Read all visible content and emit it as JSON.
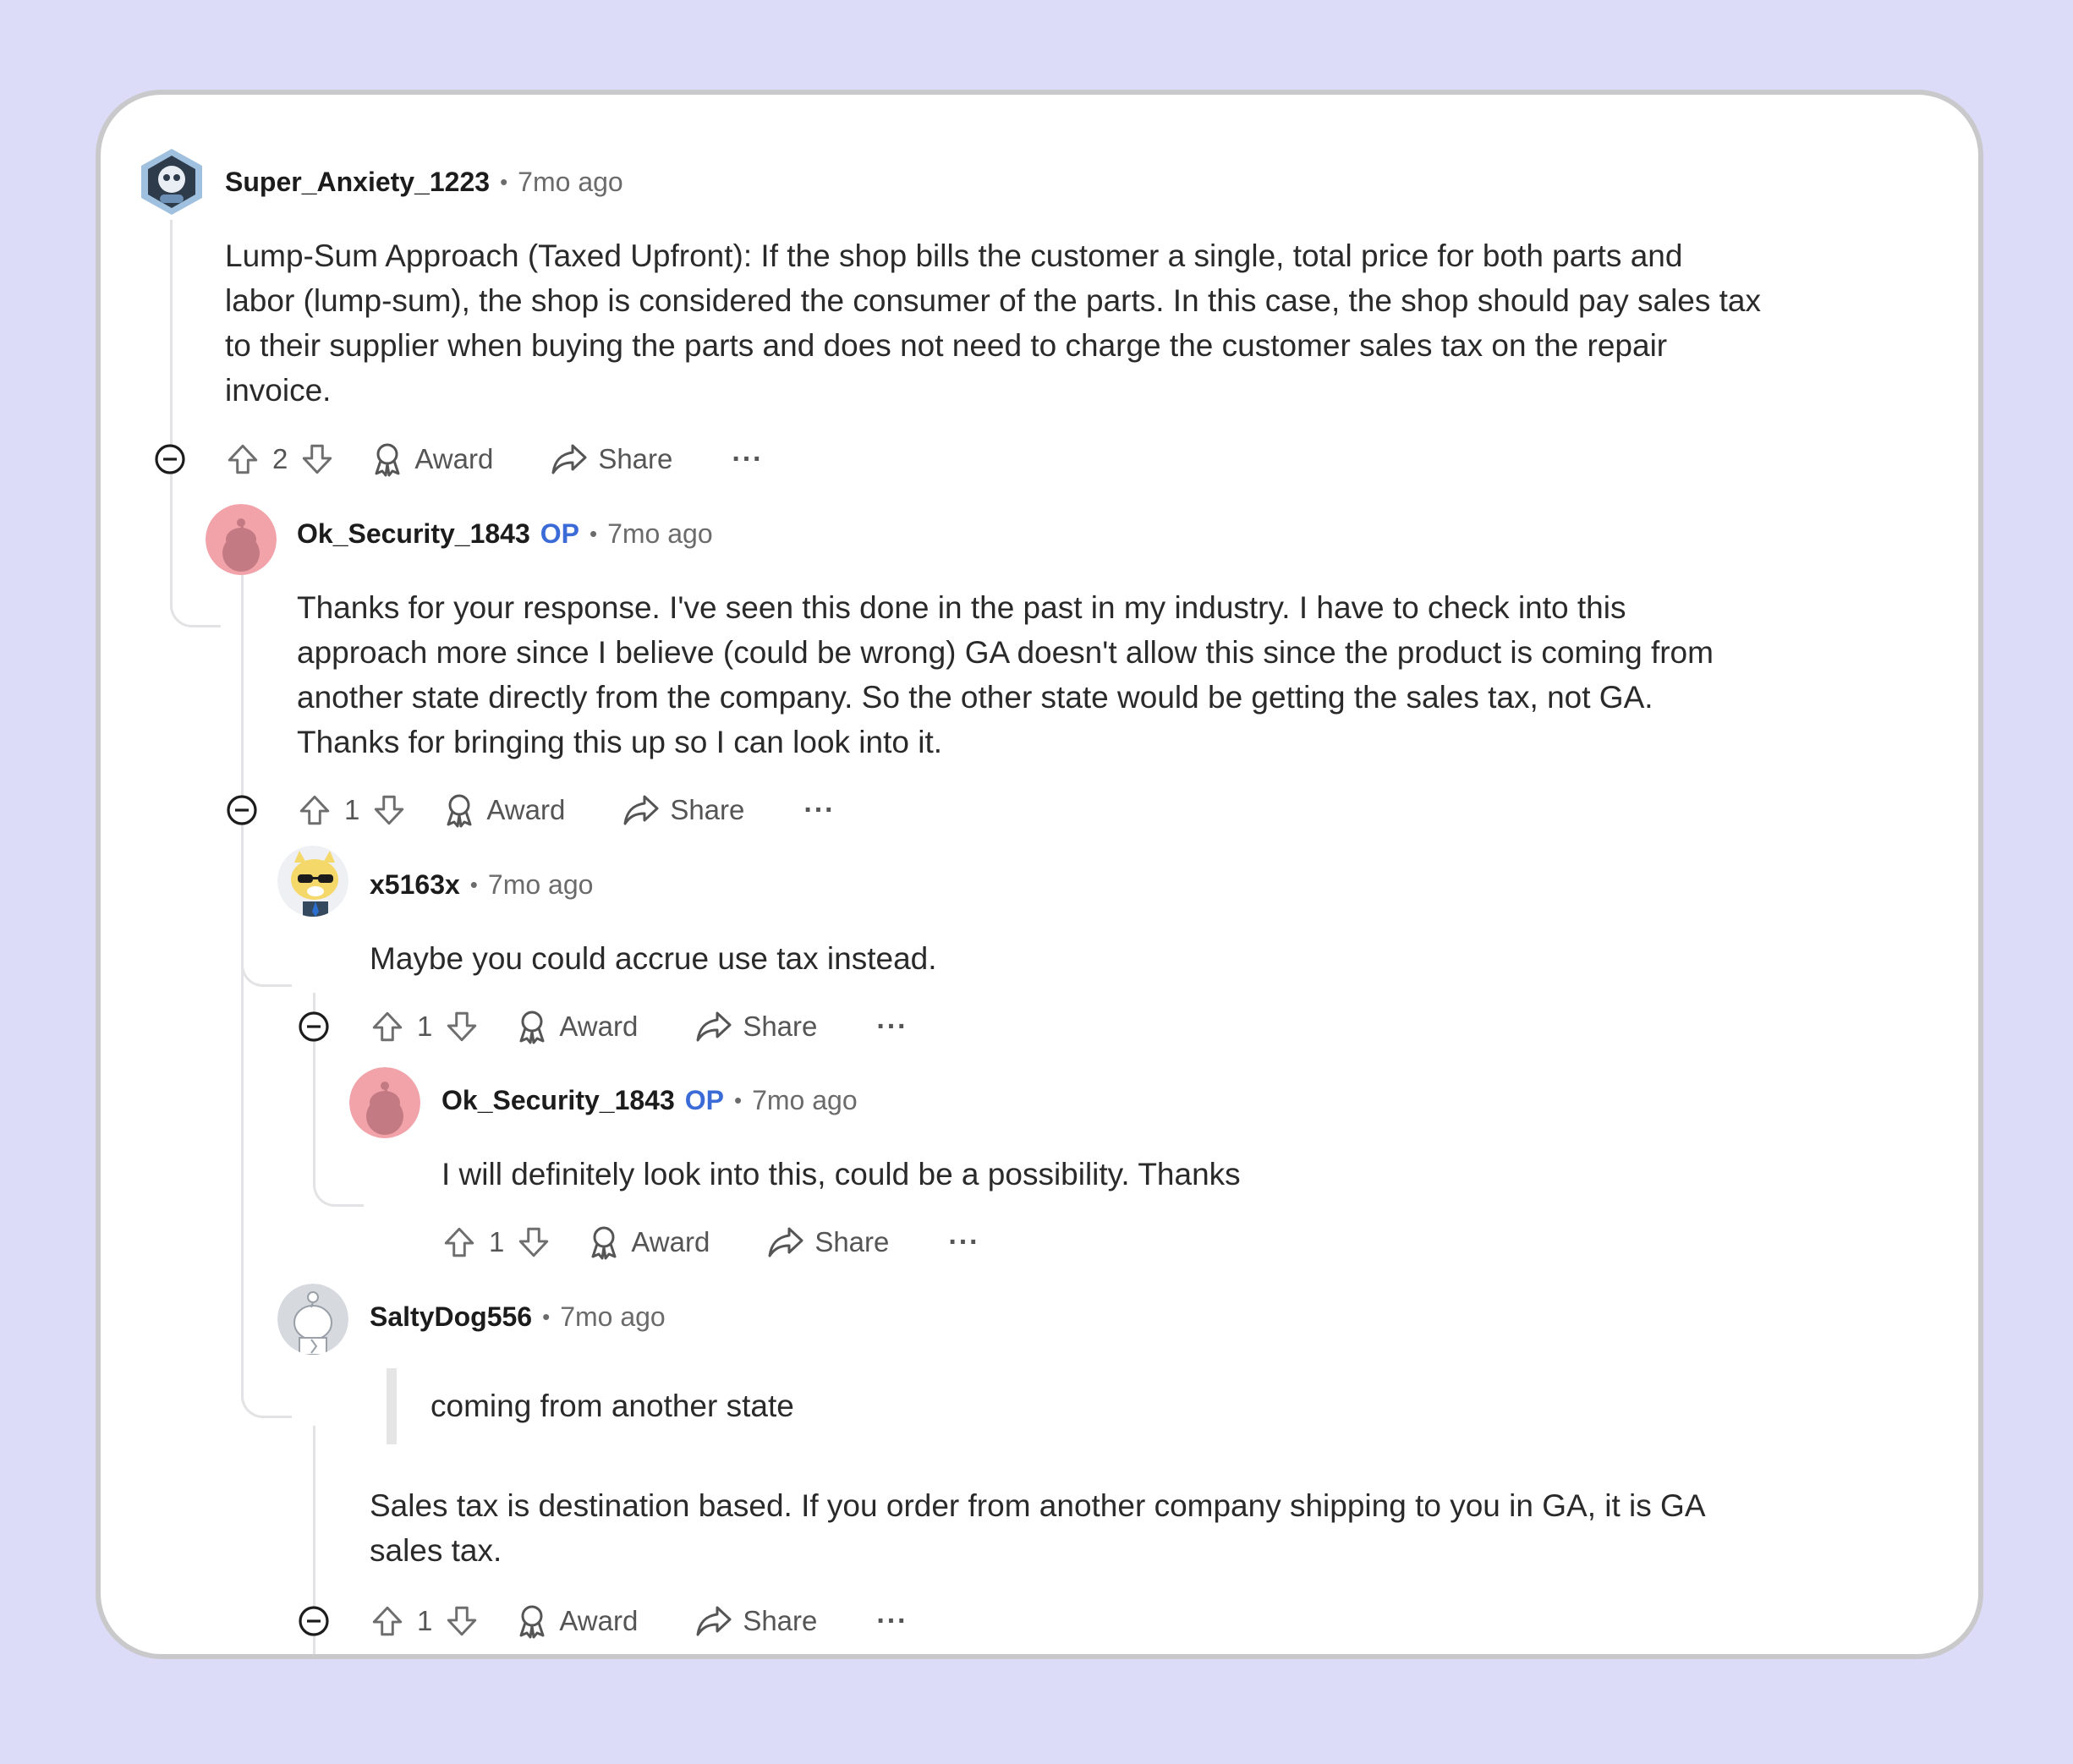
{
  "comments": [
    {
      "author": "Super_Anxiety_1223",
      "op_badge": "",
      "separator": "•",
      "time": "7mo ago",
      "body_lines": [
        "Lump-Sum Approach (Taxed Upfront): If the shop bills the customer a single, total price for both parts and",
        "labor (lump-sum), the shop is considered the consumer of the parts. In this case, the shop should pay sales tax",
        "to their supplier when buying the parts and does not need to charge the customer sales tax on the repair",
        "invoice."
      ],
      "votes": "2",
      "award_label": "Award",
      "share_label": "Share",
      "more_label": "···"
    },
    {
      "author": "Ok_Security_1843",
      "op_badge": "OP",
      "separator": "•",
      "time": "7mo ago",
      "body_lines": [
        "Thanks for your response. I've seen this done in the past in my industry. I have to check into this",
        "approach more since I believe (could be wrong) GA doesn't allow this since the product is coming from",
        "another state directly from the company. So the other state would be getting the sales tax, not GA.",
        "Thanks for bringing this up so I can look into it."
      ],
      "votes": "1",
      "award_label": "Award",
      "share_label": "Share",
      "more_label": "···"
    },
    {
      "author": "x5163x",
      "op_badge": "",
      "separator": "•",
      "time": "7mo ago",
      "body_lines": [
        "Maybe you could accrue use tax instead."
      ],
      "votes": "1",
      "award_label": "Award",
      "share_label": "Share",
      "more_label": "···"
    },
    {
      "author": "Ok_Security_1843",
      "op_badge": "OP",
      "separator": "•",
      "time": "7mo ago",
      "body_lines": [
        "I will definitely look into this, could be a possibility. Thanks"
      ],
      "votes": "1",
      "award_label": "Award",
      "share_label": "Share",
      "more_label": "···"
    },
    {
      "author": "SaltyDog556",
      "op_badge": "",
      "separator": "•",
      "time": "7mo ago",
      "quote": "coming from another state",
      "body_lines": [
        "Sales tax is destination based. If you order from another company shipping to you in GA, it is GA",
        "sales tax."
      ],
      "votes": "1",
      "award_label": "Award",
      "share_label": "Share",
      "more_label": "···"
    }
  ],
  "colors": {
    "page_background": "#dcdcf8",
    "card_background": "#ffffff",
    "op_badge": "#3b6bd6",
    "muted_text": "#6b6b6b"
  },
  "icons": [
    "collapse-icon",
    "upvote-icon",
    "downvote-icon",
    "award-icon",
    "share-icon",
    "more-options-icon"
  ]
}
